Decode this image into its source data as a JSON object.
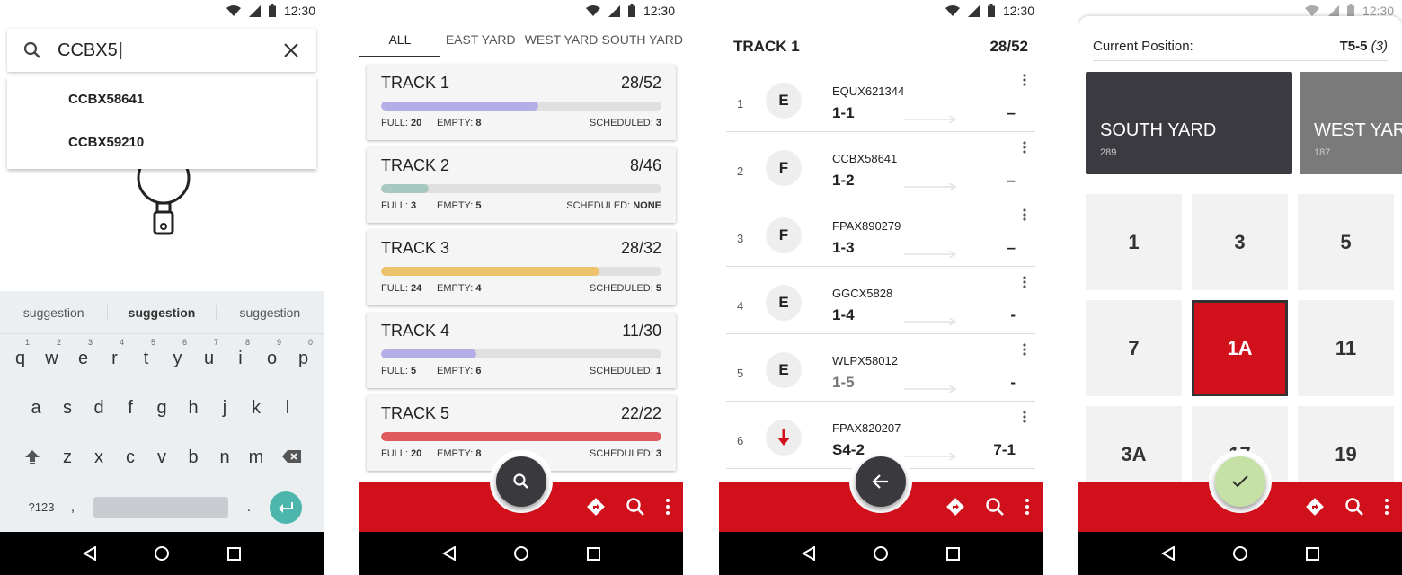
{
  "status": {
    "time": "12:30"
  },
  "screen1": {
    "search_value": "CCBX5",
    "suggestions": [
      "CCBX58641",
      "CCBX59210"
    ],
    "keyboard": {
      "suggestions": [
        "suggestion",
        "suggestion",
        "suggestion"
      ],
      "row1": [
        {
          "k": "q",
          "n": "1"
        },
        {
          "k": "w",
          "n": "2"
        },
        {
          "k": "e",
          "n": "3"
        },
        {
          "k": "r",
          "n": "4"
        },
        {
          "k": "t",
          "n": "5"
        },
        {
          "k": "y",
          "n": "6"
        },
        {
          "k": "u",
          "n": "7"
        },
        {
          "k": "i",
          "n": "8"
        },
        {
          "k": "o",
          "n": "9"
        },
        {
          "k": "p",
          "n": "0"
        }
      ],
      "row2": [
        "a",
        "s",
        "d",
        "f",
        "g",
        "h",
        "j",
        "k",
        "l"
      ],
      "row3": [
        "z",
        "x",
        "c",
        "v",
        "b",
        "n",
        "m"
      ],
      "symbols_label": "?123",
      "comma": ",",
      "period": "."
    }
  },
  "screen2": {
    "tabs": [
      "ALL",
      "EAST YARD",
      "WEST YARD",
      "SOUTH YARD"
    ],
    "full_label": "FULL:",
    "empty_label": "EMPTY:",
    "scheduled_label": "SCHEDULED:",
    "tracks": [
      {
        "name": "TRACK 1",
        "count": "28/52",
        "fill": 0.56,
        "color": "#b3aee6",
        "full": "20",
        "empty": "8",
        "scheduled": "3"
      },
      {
        "name": "TRACK 2",
        "count": "8/46",
        "fill": 0.17,
        "color": "#a7c9c0",
        "full": "3",
        "empty": "5",
        "scheduled": "NONE"
      },
      {
        "name": "TRACK 3",
        "count": "28/32",
        "fill": 0.78,
        "color": "#ecc26b",
        "full": "24",
        "empty": "4",
        "scheduled": "5"
      },
      {
        "name": "TRACK 4",
        "count": "11/30",
        "fill": 0.34,
        "color": "#b3aee6",
        "full": "5",
        "empty": "6",
        "scheduled": "1"
      },
      {
        "name": "TRACK 5",
        "count": "22/22",
        "fill": 1.0,
        "color": "#de5a5e",
        "full": "20",
        "empty": "8",
        "scheduled": "3"
      }
    ]
  },
  "screen3": {
    "title": "TRACK 1",
    "count": "28/52",
    "rows": [
      {
        "num": "1",
        "type": "E",
        "car": "EQUX621344",
        "pos": "1-1",
        "dest": "–"
      },
      {
        "num": "2",
        "type": "F",
        "car": "CCBX58641",
        "pos": "1-2",
        "dest": "–"
      },
      {
        "num": "3",
        "type": "F",
        "car": "FPAX890279",
        "pos": "1-3",
        "dest": "–"
      },
      {
        "num": "4",
        "type": "E",
        "car": "GGCX5828",
        "pos": "1-4",
        "dest": "-"
      },
      {
        "num": "5",
        "type": "E",
        "car": "WLPX58012",
        "pos": "1-5",
        "dest": "-"
      },
      {
        "num": "6",
        "type": "down-arrow-icon",
        "car": "FPAX820207",
        "pos": "S4-2",
        "dest": "7-1"
      }
    ]
  },
  "screen4": {
    "current_label": "Current Position:",
    "current_value": "T5-5",
    "current_extra": "(3)",
    "yards": [
      {
        "name": "SOUTH YARD",
        "count": "289",
        "color": "#3a3a40"
      },
      {
        "name": "WEST YARD",
        "count": "187",
        "color": "#7a7a7a"
      }
    ],
    "cells": [
      "1",
      "3",
      "5",
      "7",
      "1A",
      "11",
      "3A",
      "17",
      "19"
    ],
    "selected_cell": "1A"
  },
  "colors": {
    "accent": "#d0101a",
    "fab_dark": "#3a3a3e",
    "fab_confirm": "#c5e1a5",
    "enter": "#4db6ac"
  }
}
